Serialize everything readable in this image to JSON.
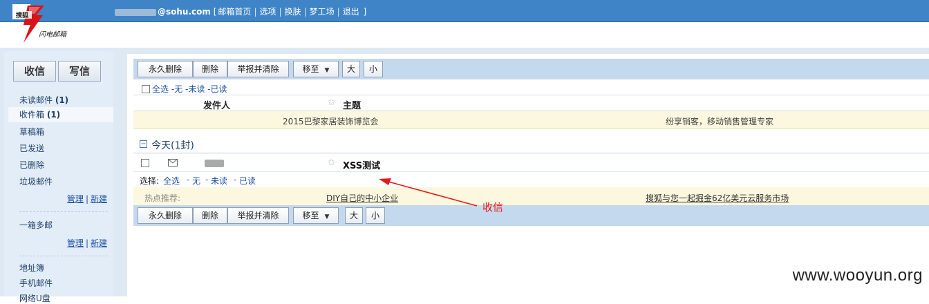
{
  "header": {
    "email_domain": "@sohu.com",
    "bracket_open": "[",
    "bracket_close": "]",
    "nav": [
      "邮箱首页",
      "选项",
      "换肤",
      "梦工场",
      "退出"
    ]
  },
  "logo": {
    "top_text": "搜狐",
    "sub_text": "闪电邮箱"
  },
  "sidebar": {
    "receive_label": "收信",
    "compose_label": "写信",
    "folders": [
      {
        "label": "未读邮件",
        "count": "(1)"
      },
      {
        "label": "收件箱",
        "count": "(1)"
      },
      {
        "label": "草稿箱",
        "count": ""
      },
      {
        "label": "已发送",
        "count": ""
      },
      {
        "label": "已删除",
        "count": ""
      },
      {
        "label": "垃圾邮件",
        "count": ""
      }
    ],
    "manage_label": "管理",
    "new_label": "新建",
    "separator": "|",
    "multi_box_label": "一箱多邮",
    "address_book_label": "地址簿",
    "mobile_mail_label": "手机邮件",
    "cut_item_label": "网络U盘"
  },
  "toolbar": {
    "perm_delete": "永久删除",
    "delete": "删除",
    "report_clear": "举报并清除",
    "move_to": "移至",
    "big": "大",
    "small": "小"
  },
  "list": {
    "select_all": "全选",
    "none": "无",
    "unread": "未读",
    "read": "已读",
    "col_sender": "发件人",
    "col_subject": "主题",
    "ad_left": "2015巴黎家居装饰博览会",
    "ad_right": "纷享销客，移动销售管理专家",
    "group_title": "今天(1封)",
    "mail_subject": "XSS测试",
    "select_label": "选择:",
    "hot_label": "热点推荐:",
    "hot_link1": "DIY自己的中小企业",
    "hot_link2": "搜狐与您一起掘金62亿美元云服务市场"
  },
  "annotation": {
    "text": "收信",
    "color": "#e3191a"
  },
  "watermark": "www.wooyun.org",
  "colors": {
    "topbar": "#3f84c6",
    "toolbar": "#c5d9ee",
    "sidebar": "#e3edf7",
    "ad_bg": "#fbf8df"
  }
}
